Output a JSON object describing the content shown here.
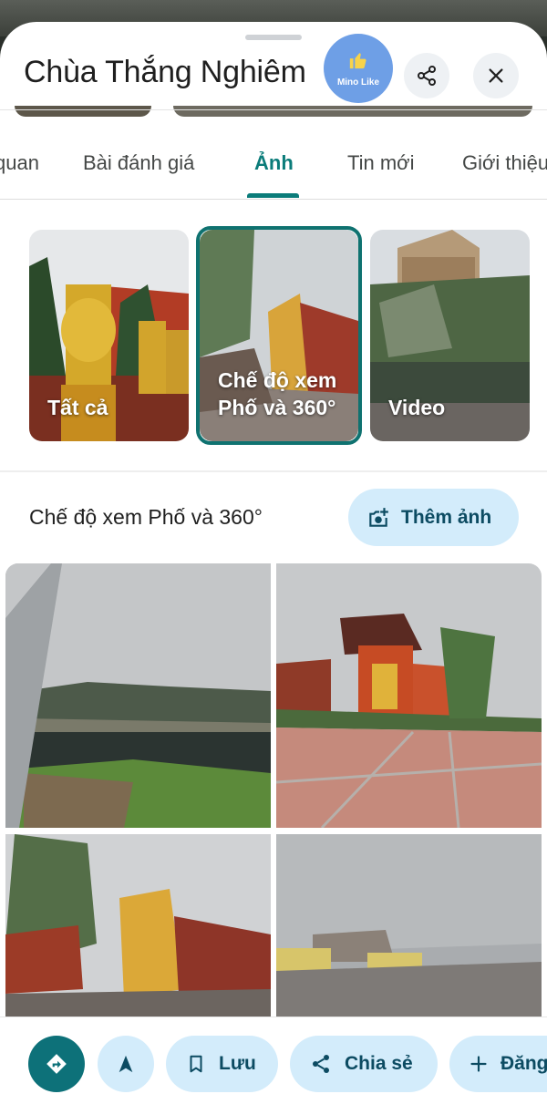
{
  "header": {
    "title": "Chùa Thắng Nghiêm",
    "mino_label": "Mino Like"
  },
  "tabs": [
    {
      "label": "quan"
    },
    {
      "label": "Bài đánh giá"
    },
    {
      "label": "Ảnh",
      "active": true
    },
    {
      "label": "Tin mới"
    },
    {
      "label": "Giới thiệu"
    }
  ],
  "categories": [
    {
      "label": "Tất cả"
    },
    {
      "label": "Chế độ xem Phố và 360°",
      "selected": true
    },
    {
      "label": "Video"
    }
  ],
  "section": {
    "title": "Chế độ xem Phố và 360°",
    "add_photo_label": "Thêm ảnh"
  },
  "bottom_actions": {
    "save_label": "Lưu",
    "share_label": "Chia sẻ",
    "post_label": "Đăng"
  },
  "colors": {
    "accent": "#0b7c7a",
    "pill_bg": "#d3ecfb",
    "pill_text": "#0c4b62",
    "directions_bg": "#0d7179",
    "mino_bg": "#6e9fe6"
  }
}
